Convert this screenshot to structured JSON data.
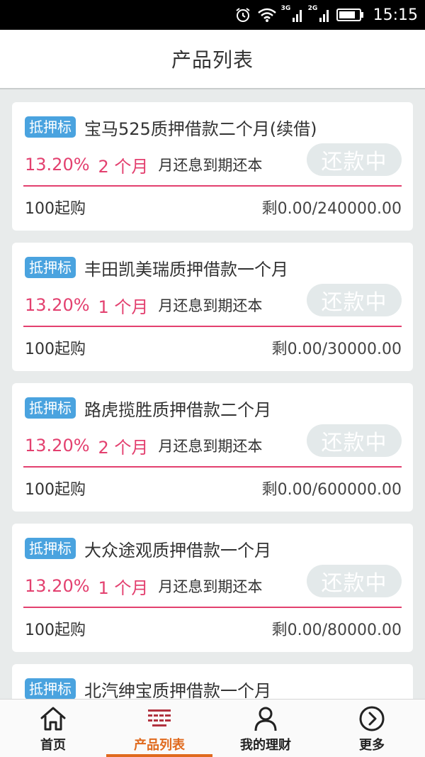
{
  "status_bar": {
    "time": "15:15",
    "net_a": "3G",
    "net_b": "2G",
    "icons": [
      "alarm-icon",
      "wifi-icon",
      "signal-3g-icon",
      "signal-2g-icon",
      "battery-icon"
    ]
  },
  "header": {
    "title": "产品列表"
  },
  "products": [
    {
      "badge": "抵押标",
      "title": "宝马525质押借款二个月(续借)",
      "rate": "13.20%",
      "term": "2 个月",
      "repay_method": "月还息到期还本",
      "status": "还款中",
      "min_buy": "100起购",
      "remaining": "剩0.00/240000.00"
    },
    {
      "badge": "抵押标",
      "title": "丰田凯美瑞质押借款一个月",
      "rate": "13.20%",
      "term": "1 个月",
      "repay_method": "月还息到期还本",
      "status": "还款中",
      "min_buy": "100起购",
      "remaining": "剩0.00/30000.00"
    },
    {
      "badge": "抵押标",
      "title": "路虎揽胜质押借款二个月",
      "rate": "13.20%",
      "term": "2 个月",
      "repay_method": "月还息到期还本",
      "status": "还款中",
      "min_buy": "100起购",
      "remaining": "剩0.00/600000.00"
    },
    {
      "badge": "抵押标",
      "title": "大众途观质押借款一个月",
      "rate": "13.20%",
      "term": "1 个月",
      "repay_method": "月还息到期还本",
      "status": "还款中",
      "min_buy": "100起购",
      "remaining": "剩0.00/80000.00"
    },
    {
      "badge": "抵押标",
      "title": "北汽绅宝质押借款一个月"
    }
  ],
  "bottom_nav": {
    "items": [
      {
        "label": "首页",
        "icon": "home-icon"
      },
      {
        "label": "产品列表",
        "icon": "product-list-icon"
      },
      {
        "label": "我的理财",
        "icon": "user-icon"
      },
      {
        "label": "更多",
        "icon": "more-icon"
      }
    ],
    "active_index": 1,
    "active_color": "#e06a1e",
    "accent_color": "#e3406f",
    "badge_color": "#4aa3df"
  }
}
